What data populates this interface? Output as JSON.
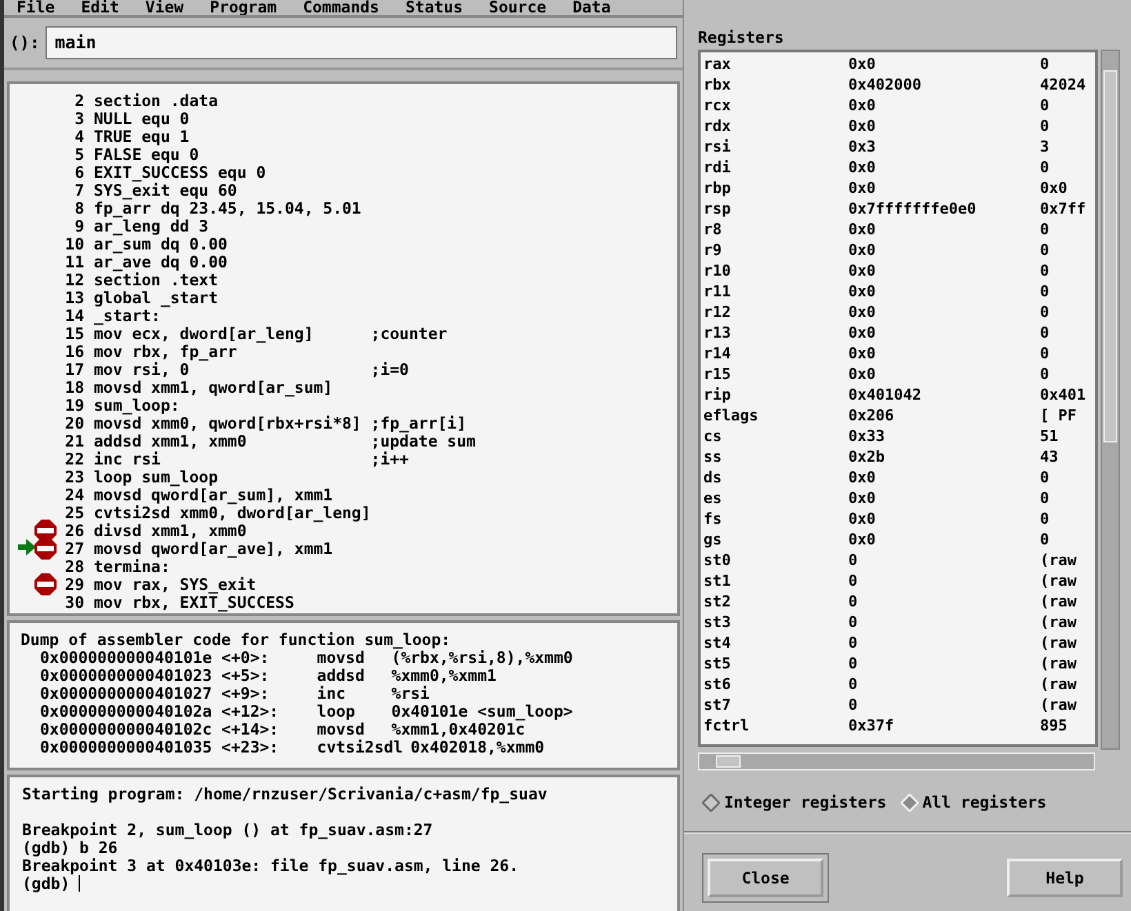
{
  "menu": [
    "File",
    "Edit",
    "View",
    "Program",
    "Commands",
    "Status",
    "Source",
    "Data"
  ],
  "argument": {
    "label": "():",
    "value": "main"
  },
  "source": {
    "lines": [
      {
        "number": "2",
        "code": "section .data",
        "breakpoint": false,
        "current": false
      },
      {
        "number": "3",
        "code": "NULL equ 0",
        "breakpoint": false,
        "current": false
      },
      {
        "number": "4",
        "code": "TRUE equ 1",
        "breakpoint": false,
        "current": false
      },
      {
        "number": "5",
        "code": "FALSE equ 0",
        "breakpoint": false,
        "current": false
      },
      {
        "number": "6",
        "code": "EXIT_SUCCESS equ 0",
        "breakpoint": false,
        "current": false
      },
      {
        "number": "7",
        "code": "SYS_exit equ 60",
        "breakpoint": false,
        "current": false
      },
      {
        "number": "8",
        "code": "fp_arr dq 23.45, 15.04, 5.01",
        "breakpoint": false,
        "current": false
      },
      {
        "number": "9",
        "code": "ar_leng dd 3",
        "breakpoint": false,
        "current": false
      },
      {
        "number": "10",
        "code": "ar_sum dq 0.00",
        "breakpoint": false,
        "current": false
      },
      {
        "number": "11",
        "code": "ar_ave dq 0.00",
        "breakpoint": false,
        "current": false
      },
      {
        "number": "12",
        "code": "section .text",
        "breakpoint": false,
        "current": false
      },
      {
        "number": "13",
        "code": "global _start",
        "breakpoint": false,
        "current": false
      },
      {
        "number": "14",
        "code": "_start:",
        "breakpoint": false,
        "current": false
      },
      {
        "number": "15",
        "code": "mov ecx, dword[ar_leng]",
        "comment": ";counter",
        "breakpoint": false,
        "current": false
      },
      {
        "number": "16",
        "code": "mov rbx, fp_arr",
        "breakpoint": false,
        "current": false
      },
      {
        "number": "17",
        "code": "mov rsi, 0",
        "comment": ";i=0",
        "breakpoint": false,
        "current": false
      },
      {
        "number": "18",
        "code": "movsd xmm1, qword[ar_sum]",
        "breakpoint": false,
        "current": false
      },
      {
        "number": "19",
        "code": "sum_loop:",
        "breakpoint": false,
        "current": false
      },
      {
        "number": "20",
        "code": "movsd xmm0, qword[rbx+rsi*8]",
        "comment": ";fp_arr[i]",
        "breakpoint": false,
        "current": false
      },
      {
        "number": "21",
        "code": "addsd xmm1, xmm0",
        "comment": ";update sum",
        "breakpoint": false,
        "current": false
      },
      {
        "number": "22",
        "code": "inc rsi",
        "comment": ";i++",
        "breakpoint": false,
        "current": false
      },
      {
        "number": "23",
        "code": "loop sum_loop",
        "breakpoint": false,
        "current": false
      },
      {
        "number": "24",
        "code": "movsd qword[ar_sum], xmm1",
        "breakpoint": false,
        "current": false
      },
      {
        "number": "25",
        "code": "cvtsi2sd xmm0, dword[ar_leng]",
        "breakpoint": false,
        "current": false
      },
      {
        "number": "26",
        "code": "divsd xmm1, xmm0",
        "breakpoint": true,
        "current": false
      },
      {
        "number": "27",
        "code": "movsd qword[ar_ave], xmm1",
        "breakpoint": true,
        "current": true
      },
      {
        "number": "28",
        "code": "termina:",
        "breakpoint": false,
        "current": false
      },
      {
        "number": "29",
        "code": "mov rax, SYS_exit",
        "breakpoint": true,
        "current": false
      },
      {
        "number": "30",
        "code": "mov rbx, EXIT_SUCCESS",
        "breakpoint": false,
        "current": false
      }
    ]
  },
  "assembler": {
    "title": "Dump of assembler code for function sum_loop:",
    "rows": [
      {
        "address": "0x000000000040101e",
        "offset": "<+0>:",
        "mnemonic": "movsd",
        "operands": "(%rbx,%rsi,8),%xmm0"
      },
      {
        "address": "0x0000000000401023",
        "offset": "<+5>:",
        "mnemonic": "addsd",
        "operands": "%xmm0,%xmm1"
      },
      {
        "address": "0x0000000000401027",
        "offset": "<+9>:",
        "mnemonic": "inc",
        "operands": "%rsi"
      },
      {
        "address": "0x000000000040102a",
        "offset": "<+12>:",
        "mnemonic": "loop",
        "operands": "0x40101e <sum_loop>"
      },
      {
        "address": "0x000000000040102c",
        "offset": "<+14>:",
        "mnemonic": "movsd",
        "operands": "%xmm1,0x40201c"
      },
      {
        "address": "0x0000000000401035",
        "offset": "<+23>:",
        "mnemonic": "cvtsi2sdl",
        "operands": "0x402018,%xmm0"
      }
    ]
  },
  "console": {
    "paragraphs": [
      [
        "Starting program: /home/rnzuser/Scrivania/c+asm/fp_suav"
      ],
      [
        "Breakpoint 2, sum_loop () at fp_suav.asm:27",
        "(gdb) b 26",
        "Breakpoint 3 at 0x40103e: file fp_suav.asm, line 26.",
        "(gdb)"
      ]
    ]
  },
  "registers_dialog": {
    "title": "Registers",
    "rows": [
      {
        "name": "rax",
        "value": "0x0",
        "natural": "0"
      },
      {
        "name": "rbx",
        "value": "0x402000",
        "natural": "42024"
      },
      {
        "name": "rcx",
        "value": "0x0",
        "natural": "0"
      },
      {
        "name": "rdx",
        "value": "0x0",
        "natural": "0"
      },
      {
        "name": "rsi",
        "value": "0x3",
        "natural": "3"
      },
      {
        "name": "rdi",
        "value": "0x0",
        "natural": "0"
      },
      {
        "name": "rbp",
        "value": "0x0",
        "natural": "0x0"
      },
      {
        "name": "rsp",
        "value": "0x7fffffffe0e0",
        "natural": "0x7ff"
      },
      {
        "name": "r8",
        "value": "0x0",
        "natural": "0"
      },
      {
        "name": "r9",
        "value": "0x0",
        "natural": "0"
      },
      {
        "name": "r10",
        "value": "0x0",
        "natural": "0"
      },
      {
        "name": "r11",
        "value": "0x0",
        "natural": "0"
      },
      {
        "name": "r12",
        "value": "0x0",
        "natural": "0"
      },
      {
        "name": "r13",
        "value": "0x0",
        "natural": "0"
      },
      {
        "name": "r14",
        "value": "0x0",
        "natural": "0"
      },
      {
        "name": "r15",
        "value": "0x0",
        "natural": "0"
      },
      {
        "name": "rip",
        "value": "0x401042",
        "natural": "0x401"
      },
      {
        "name": "eflags",
        "value": "0x206",
        "natural": "[ PF"
      },
      {
        "name": "cs",
        "value": "0x33",
        "natural": "51"
      },
      {
        "name": "ss",
        "value": "0x2b",
        "natural": "43"
      },
      {
        "name": "ds",
        "value": "0x0",
        "natural": "0"
      },
      {
        "name": "es",
        "value": "0x0",
        "natural": "0"
      },
      {
        "name": "fs",
        "value": "0x0",
        "natural": "0"
      },
      {
        "name": "gs",
        "value": "0x0",
        "natural": "0"
      },
      {
        "name": "st0",
        "value": "0",
        "natural": "(raw"
      },
      {
        "name": "st1",
        "value": "0",
        "natural": "(raw"
      },
      {
        "name": "st2",
        "value": "0",
        "natural": "(raw"
      },
      {
        "name": "st3",
        "value": "0",
        "natural": "(raw"
      },
      {
        "name": "st4",
        "value": "0",
        "natural": "(raw"
      },
      {
        "name": "st5",
        "value": "0",
        "natural": "(raw"
      },
      {
        "name": "st6",
        "value": "0",
        "natural": "(raw"
      },
      {
        "name": "st7",
        "value": "0",
        "natural": "(raw"
      },
      {
        "name": "fctrl",
        "value": "0x37f",
        "natural": "895"
      }
    ],
    "options": [
      {
        "label": "Integer registers",
        "selected": false
      },
      {
        "label": "All registers",
        "selected": true
      }
    ],
    "buttons": [
      {
        "label": "Close",
        "default": true
      },
      {
        "label": "Help",
        "default": false
      }
    ]
  }
}
